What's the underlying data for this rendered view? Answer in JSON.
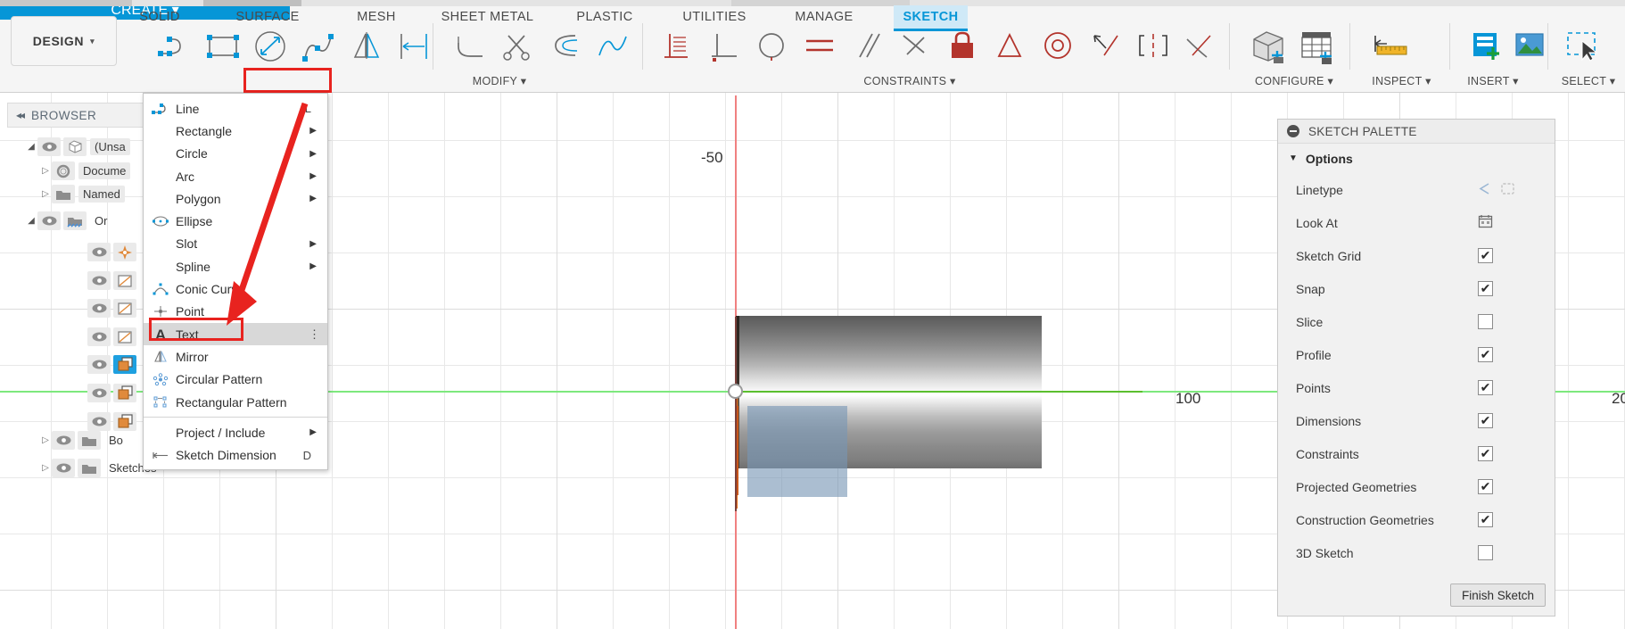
{
  "app": {
    "workspace_label": "DESIGN",
    "workspace_caret": "▾"
  },
  "tabs": [
    {
      "label": "SOLID",
      "active": false
    },
    {
      "label": "SURFACE",
      "active": false
    },
    {
      "label": "MESH",
      "active": false
    },
    {
      "label": "SHEET METAL",
      "active": false
    },
    {
      "label": "PLASTIC",
      "active": false
    },
    {
      "label": "UTILITIES",
      "active": false
    },
    {
      "label": "MANAGE",
      "active": false
    },
    {
      "label": "SKETCH",
      "active": true
    }
  ],
  "ribbon_groups": {
    "create": "CREATE ▾",
    "modify": "MODIFY ▾",
    "constraints": "CONSTRAINTS ▾",
    "configure": "CONFIGURE ▾",
    "inspect": "INSPECT ▾",
    "insert": "INSERT ▾",
    "select": "SELECT ▾"
  },
  "browser": {
    "collapse_icon": "◂◂",
    "title": "BROWSER",
    "rows": [
      {
        "indent": 28,
        "arrow": "open",
        "eye": true,
        "icon": "body-cube-icon",
        "label": "(Unsa",
        "selected": false
      },
      {
        "indent": 46,
        "arrow": "closed",
        "eye": false,
        "icon": "gear-icon",
        "label": "Docume",
        "selected": false
      },
      {
        "indent": 46,
        "arrow": "closed",
        "eye": false,
        "icon": "folder-icon",
        "label": "Named",
        "selected": false
      },
      {
        "indent": 28,
        "arrow": "open",
        "eye": true,
        "icon": "origin-folder-icon",
        "label": "Or",
        "selected": false
      },
      {
        "indent": 76,
        "arrow": "none",
        "eye": true,
        "icon": "origin-point-icon",
        "label": "",
        "selected": false
      },
      {
        "indent": 76,
        "arrow": "none",
        "eye": true,
        "icon": "plane-icon",
        "label": "",
        "selected": false
      },
      {
        "indent": 76,
        "arrow": "none",
        "eye": true,
        "icon": "plane-icon",
        "label": "",
        "selected": false
      },
      {
        "indent": 76,
        "arrow": "none",
        "eye": true,
        "icon": "plane-icon",
        "label": "",
        "selected": false
      },
      {
        "indent": 76,
        "arrow": "none",
        "eye": true,
        "icon": "sketch-icon",
        "label": "",
        "selected": true
      },
      {
        "indent": 76,
        "arrow": "none",
        "eye": true,
        "icon": "sketch-icon",
        "label": "",
        "selected": false
      },
      {
        "indent": 76,
        "arrow": "none",
        "eye": true,
        "icon": "sketch-icon",
        "label": "",
        "selected": false
      },
      {
        "indent": 46,
        "arrow": "closed",
        "eye": true,
        "icon": "folder-icon",
        "label": "Bo",
        "selected": false
      },
      {
        "indent": 46,
        "arrow": "closed",
        "eye": true,
        "icon": "folder-icon",
        "label": "Sketches",
        "selected": false
      }
    ]
  },
  "create_menu": {
    "items": [
      {
        "label": "Line",
        "icon": "line-icon",
        "shortcut": "L",
        "submenu": false
      },
      {
        "label": "Rectangle",
        "icon": "",
        "shortcut": "",
        "submenu": true
      },
      {
        "label": "Circle",
        "icon": "",
        "shortcut": "",
        "submenu": true
      },
      {
        "label": "Arc",
        "icon": "",
        "shortcut": "",
        "submenu": true
      },
      {
        "label": "Polygon",
        "icon": "",
        "shortcut": "",
        "submenu": true
      },
      {
        "label": "Ellipse",
        "icon": "ellipse-icon",
        "shortcut": "",
        "submenu": false
      },
      {
        "label": "Slot",
        "icon": "",
        "shortcut": "",
        "submenu": true
      },
      {
        "label": "Spline",
        "icon": "",
        "shortcut": "",
        "submenu": true
      },
      {
        "label": "Conic Curve",
        "icon": "conic-curve-icon",
        "shortcut": "",
        "submenu": false
      },
      {
        "label": "Point",
        "icon": "point-icon",
        "shortcut": "",
        "submenu": false
      },
      {
        "label": "Text",
        "icon": "text-icon",
        "shortcut": "",
        "submenu": false,
        "highlighted": true,
        "overflow": "⋮"
      },
      {
        "label": "Mirror",
        "icon": "mirror-icon",
        "shortcut": "",
        "submenu": false
      },
      {
        "label": "Circular Pattern",
        "icon": "circular-pattern-icon",
        "shortcut": "",
        "submenu": false
      },
      {
        "label": "Rectangular Pattern",
        "icon": "rectangular-pattern-icon",
        "shortcut": "",
        "submenu": false
      },
      {
        "label": "Project / Include",
        "icon": "",
        "shortcut": "",
        "submenu": true
      },
      {
        "label": "Sketch Dimension",
        "icon": "dimension-icon",
        "shortcut": "D",
        "submenu": false
      }
    ]
  },
  "palette": {
    "collapse_icon": "minus-icon",
    "title": "SKETCH PALETTE",
    "section": "Options",
    "section_caret": "▼",
    "rows": [
      {
        "label": "Linetype",
        "control": "linetype"
      },
      {
        "label": "Look At",
        "control": "lookat"
      },
      {
        "label": "Sketch Grid",
        "control": "checkbox",
        "checked": true
      },
      {
        "label": "Snap",
        "control": "checkbox",
        "checked": true
      },
      {
        "label": "Slice",
        "control": "checkbox",
        "checked": false
      },
      {
        "label": "Profile",
        "control": "checkbox",
        "checked": true
      },
      {
        "label": "Points",
        "control": "checkbox",
        "checked": true
      },
      {
        "label": "Dimensions",
        "control": "checkbox",
        "checked": true
      },
      {
        "label": "Constraints",
        "control": "checkbox",
        "checked": true
      },
      {
        "label": "Projected Geometries",
        "control": "checkbox",
        "checked": true
      },
      {
        "label": "Construction Geometries",
        "control": "checkbox",
        "checked": true
      },
      {
        "label": "3D Sketch",
        "control": "checkbox",
        "checked": false
      }
    ],
    "finish_button": "Finish Sketch"
  },
  "canvas": {
    "tick_neg50": "-50",
    "tick_100": "100",
    "tick_200": "20"
  },
  "colors": {
    "accent_blue": "#0696d7",
    "annotation_red": "#e8231f",
    "x_axis_green": "#7ee87e",
    "y_axis_red": "#f08080",
    "selection_blue": "#7896b4"
  }
}
